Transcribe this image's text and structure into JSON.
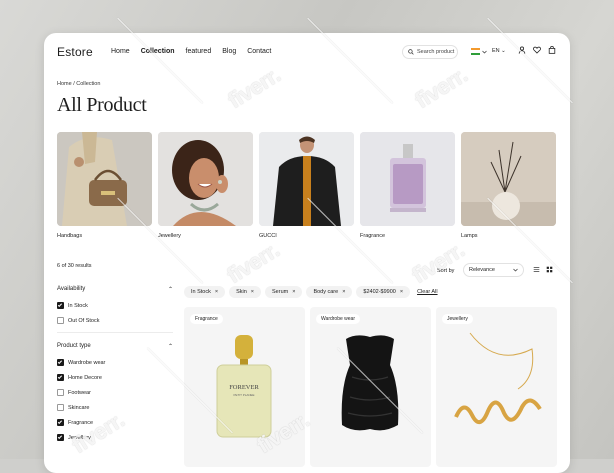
{
  "brand": "Estore",
  "nav": {
    "links": [
      "Home",
      "Collection",
      "featured",
      "Blog",
      "Contact"
    ],
    "active": "Collection",
    "search_placeholder": "Search product",
    "language": "EN"
  },
  "breadcrumb": "Home / Collection",
  "page_title": "All Product",
  "categories": [
    "Handbags",
    "Jewellery",
    "GUCCI",
    "Fragrance",
    "Lamps"
  ],
  "results_text": "6 of 30 results",
  "sort": {
    "label": "Sort by",
    "value": "Relevance"
  },
  "filters": {
    "availability": {
      "title": "Availability",
      "options": [
        {
          "label": "In Stock",
          "checked": true
        },
        {
          "label": "Out Of Stock",
          "checked": false
        }
      ]
    },
    "product_type": {
      "title": "Product type",
      "options": [
        {
          "label": "Wardrobe wear",
          "checked": true
        },
        {
          "label": "Home Decore",
          "checked": true
        },
        {
          "label": "Footwear",
          "checked": false
        },
        {
          "label": "Skincare",
          "checked": false
        },
        {
          "label": "Fragrance",
          "checked": true
        },
        {
          "label": "Jewellery",
          "checked": true
        }
      ]
    }
  },
  "active_chips": [
    "In Stock",
    "Skin",
    "Serum",
    "Body care",
    "$2402-$9900"
  ],
  "clear_all": "Clear All",
  "products": [
    {
      "tag": "Fragrance",
      "bottle_text": "FOREVER",
      "bottle_sub": "PETIT PLANEE"
    },
    {
      "tag": "Wardrobe wear"
    },
    {
      "tag": "Jewellery"
    }
  ],
  "watermark": "fiverr."
}
